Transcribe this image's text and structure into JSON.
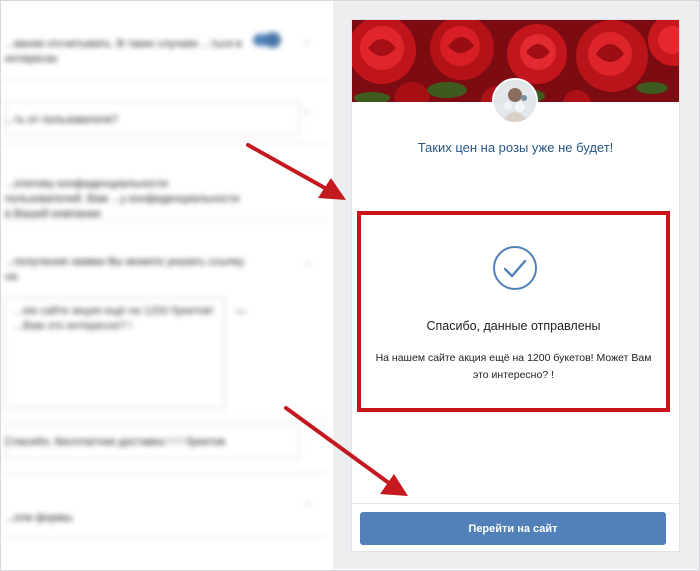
{
  "settings_panel": {
    "rows": [
      {
        "text": "...вание отсчитывать. В таких случаях ...ться в интересах"
      },
      {
        "text": "...ть от пользователя?"
      },
      {
        "text": "...олитику конфиденциальности пользователей. Вам ...у конфиденциальности в Вашей компании"
      },
      {
        "text": "...получения заявки Вы можете указать ссылку на"
      },
      {
        "text": "Спасибо, Бесплатная доставка ! ! ! букетов"
      },
      {
        "text": "...оли формы"
      }
    ],
    "textarea_value": "...ем сайте акция ещё на 1200 букетов! ...Вам это интересно? !",
    "colors": {
      "toggle": "#5181b8"
    }
  },
  "preview": {
    "card_title": "Таких цен на розы уже не будет!",
    "success_title": "Спасибо, данные отправлены",
    "success_text": "На нашем сайте акция ещё на 1200 букетов! Может Вам это интересно? !",
    "button_label": "Перейти на сайт",
    "icons": {
      "avatar": "bouquet-avatar",
      "check": "checkmark-circle-icon",
      "cover": "red-roses-photo"
    },
    "colors": {
      "accent": "#5181b8",
      "highlight_border": "#c8141a",
      "arrow": "#c41a1f",
      "title": "#2a5885"
    }
  }
}
